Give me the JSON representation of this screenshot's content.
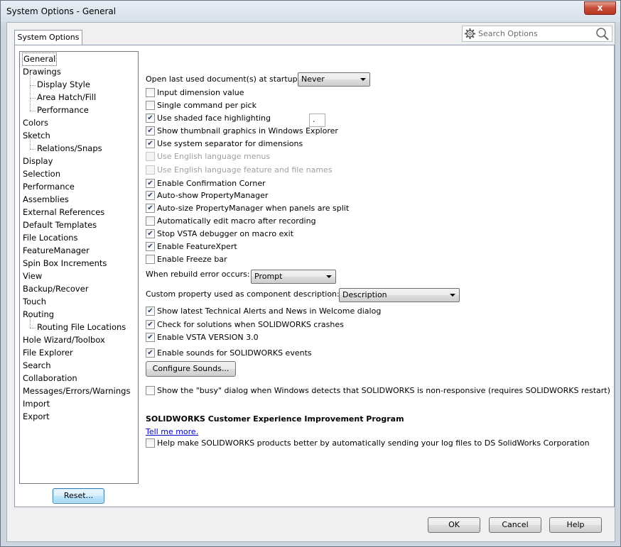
{
  "window": {
    "title": "System Options - General",
    "close_glyph": "x"
  },
  "tab": {
    "label": "System Options"
  },
  "search": {
    "placeholder": "Search Options"
  },
  "tree": {
    "items": [
      {
        "label": "General",
        "indent": false,
        "selected": true
      },
      {
        "label": "Drawings",
        "indent": false
      },
      {
        "label": "Display Style",
        "indent": true
      },
      {
        "label": "Area Hatch/Fill",
        "indent": true
      },
      {
        "label": "Performance",
        "indent": true
      },
      {
        "label": "Colors",
        "indent": false
      },
      {
        "label": "Sketch",
        "indent": false
      },
      {
        "label": "Relations/Snaps",
        "indent": true
      },
      {
        "label": "Display",
        "indent": false
      },
      {
        "label": "Selection",
        "indent": false
      },
      {
        "label": "Performance",
        "indent": false
      },
      {
        "label": "Assemblies",
        "indent": false
      },
      {
        "label": "External References",
        "indent": false
      },
      {
        "label": "Default Templates",
        "indent": false
      },
      {
        "label": "File Locations",
        "indent": false
      },
      {
        "label": "FeatureManager",
        "indent": false
      },
      {
        "label": "Spin Box Increments",
        "indent": false
      },
      {
        "label": "View",
        "indent": false
      },
      {
        "label": "Backup/Recover",
        "indent": false
      },
      {
        "label": "Touch",
        "indent": false
      },
      {
        "label": "Routing",
        "indent": false
      },
      {
        "label": "Routing File Locations",
        "indent": true
      },
      {
        "label": "Hole Wizard/Toolbox",
        "indent": false
      },
      {
        "label": "File Explorer",
        "indent": false
      },
      {
        "label": "Search",
        "indent": false
      },
      {
        "label": "Collaboration",
        "indent": false
      },
      {
        "label": "Messages/Errors/Warnings",
        "indent": false
      },
      {
        "label": "Import",
        "indent": false
      },
      {
        "label": "Export",
        "indent": false
      }
    ]
  },
  "reset_label": "Reset...",
  "startup": {
    "label": "Open last used document(s) at startup:",
    "value": "Never"
  },
  "options_a": [
    {
      "label": "Input dimension value",
      "checked": false,
      "disabled": false
    },
    {
      "label": "Single command per pick",
      "checked": false,
      "disabled": false
    },
    {
      "label": "Use shaded face highlighting",
      "checked": true,
      "disabled": false
    },
    {
      "label": "Show thumbnail graphics in Windows Explorer",
      "checked": true,
      "disabled": false
    },
    {
      "label": "Use system separator for dimensions",
      "checked": true,
      "disabled": false
    },
    {
      "label": "Use English language menus",
      "checked": false,
      "disabled": true
    },
    {
      "label": "Use English language feature and file names",
      "checked": false,
      "disabled": true
    },
    {
      "label": "Enable Confirmation Corner",
      "checked": true,
      "disabled": false
    },
    {
      "label": "Auto-show PropertyManager",
      "checked": true,
      "disabled": false
    },
    {
      "label": "Auto-size PropertyManager when panels are split",
      "checked": true,
      "disabled": false
    },
    {
      "label": "Automatically edit macro after recording",
      "checked": false,
      "disabled": false
    },
    {
      "label": "Stop VSTA debugger on macro exit",
      "checked": true,
      "disabled": false
    },
    {
      "label": "Enable FeatureXpert",
      "checked": true,
      "disabled": false
    },
    {
      "label": "Enable Freeze bar",
      "checked": false,
      "disabled": false
    }
  ],
  "separator_value": ".",
  "rebuild": {
    "label": "When rebuild error occurs:",
    "value": "Prompt"
  },
  "custom_prop": {
    "label": "Custom property used as component description:",
    "value": "Description"
  },
  "options_b": [
    {
      "label": "Show latest Technical Alerts and News in Welcome dialog",
      "checked": true
    },
    {
      "label": "Check for solutions when SOLIDWORKS crashes",
      "checked": true
    },
    {
      "label": "Enable VSTA VERSION 3.0",
      "checked": true
    },
    {
      "label": "Enable sounds for SOLIDWORKS events",
      "checked": true
    }
  ],
  "configure_sounds_label": "Configure Sounds...",
  "busy_dialog": {
    "label": "Show the \"busy\" dialog when Windows detects that SOLIDWORKS is non-responsive (requires SOLIDWORKS restart)",
    "checked": false
  },
  "ceip": {
    "title": "SOLIDWORKS Customer Experience Improvement Program",
    "link": "Tell me more.",
    "option_label": "Help make SOLIDWORKS products better by automatically sending your log files to DS SolidWorks Corporation",
    "checked": false
  },
  "footer": {
    "ok": "OK",
    "cancel": "Cancel",
    "help": "Help"
  },
  "check_glyph": "✔"
}
